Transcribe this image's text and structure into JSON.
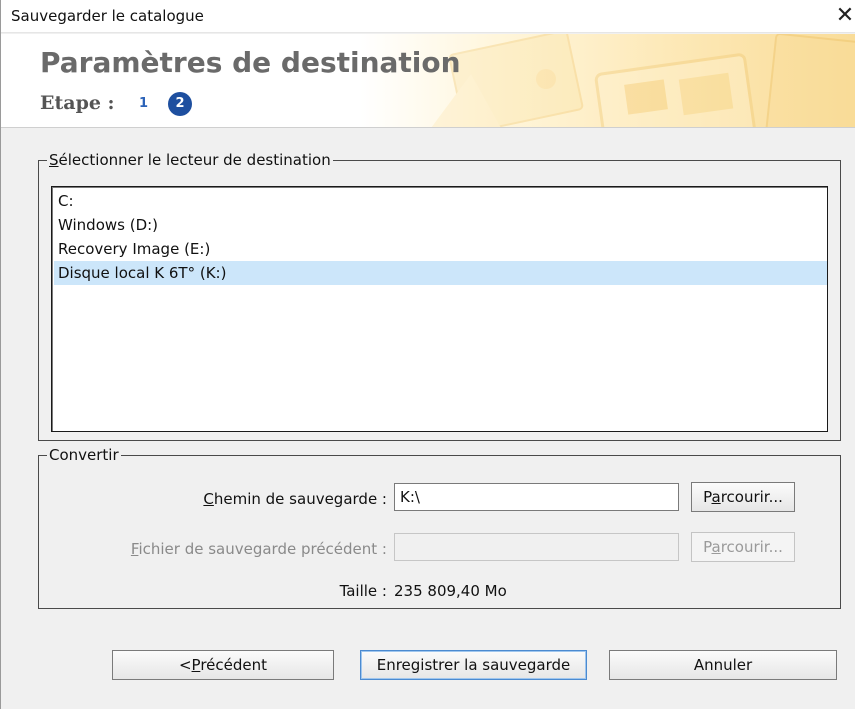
{
  "window": {
    "title": "Sauvegarder le catalogue",
    "close_glyph": "✕"
  },
  "header": {
    "title": "Paramètres de destination",
    "step_label": "Etape : ",
    "steps": [
      "1",
      "2"
    ],
    "current_step": 2
  },
  "destination": {
    "legend_accel": "S",
    "legend_rest": "électionner le lecteur de destination",
    "drives": [
      "C:",
      "Windows (D:)",
      "Recovery Image (E:)",
      "Disque local K 6T° (K:)"
    ],
    "selected_index": 3
  },
  "convert": {
    "legend": "Convertir",
    "path_label_accel": "C",
    "path_label_rest": "hemin de sauvegarde :",
    "path_value": "K:\\",
    "browse1_pre": "P",
    "browse1_accel": "a",
    "browse1_rest": "rcourir...",
    "prev_label_accel": "F",
    "prev_label_rest": "ichier de sauvegarde précédent :",
    "prev_value": "",
    "browse2_pre": "P",
    "browse2_accel": "a",
    "browse2_rest": "rcourir...",
    "size_label": "Taille :",
    "size_value": "235 809,40 Mo"
  },
  "footer": {
    "prev_lt": "<",
    "prev_accel": "P",
    "prev_rest": "récédent",
    "save": "Enregistrer la sauvegarde",
    "cancel": "Annuler"
  },
  "colors": {
    "selection": "#cce6fa",
    "step_active": "#1e4f9f",
    "step_inactive_text": "#2c63b8"
  }
}
